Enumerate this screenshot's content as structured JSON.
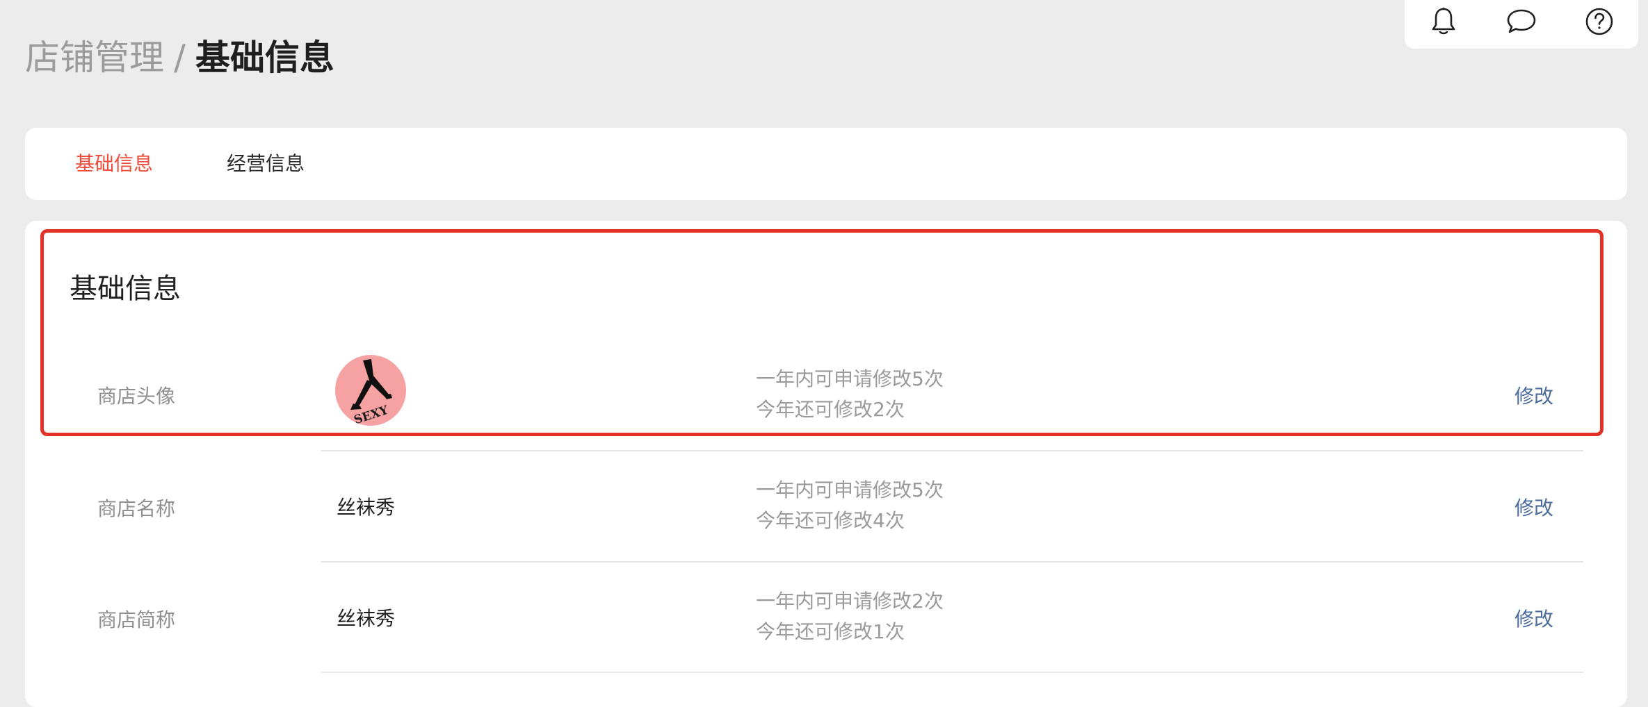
{
  "breadcrumb": {
    "parent": "店铺管理",
    "separator": "/",
    "current": "基础信息"
  },
  "header_icons": [
    "bell-icon",
    "chat-icon",
    "help-icon"
  ],
  "tabs": [
    {
      "label": "基础信息",
      "active": true
    },
    {
      "label": "经营信息",
      "active": false
    }
  ],
  "section": {
    "title": "基础信息",
    "rows": [
      {
        "label": "商店头像",
        "value": "",
        "avatar_text": "SEXY",
        "note_line1": "一年内可申请修改5次",
        "note_line2": "今年还可修改2次",
        "action": "修改"
      },
      {
        "label": "商店名称",
        "value": "丝袜秀",
        "note_line1": "一年内可申请修改5次",
        "note_line2": "今年还可修改4次",
        "action": "修改"
      },
      {
        "label": "商店简称",
        "value": "丝袜秀",
        "note_line1": "一年内可申请修改2次",
        "note_line2": "今年还可修改1次",
        "action": "修改"
      }
    ]
  },
  "colors": {
    "accent": "#f04b3a",
    "highlight_border": "#e33127",
    "link": "#4b6a99",
    "background": "#ececec",
    "avatar_bg": "#f7a2a2"
  }
}
